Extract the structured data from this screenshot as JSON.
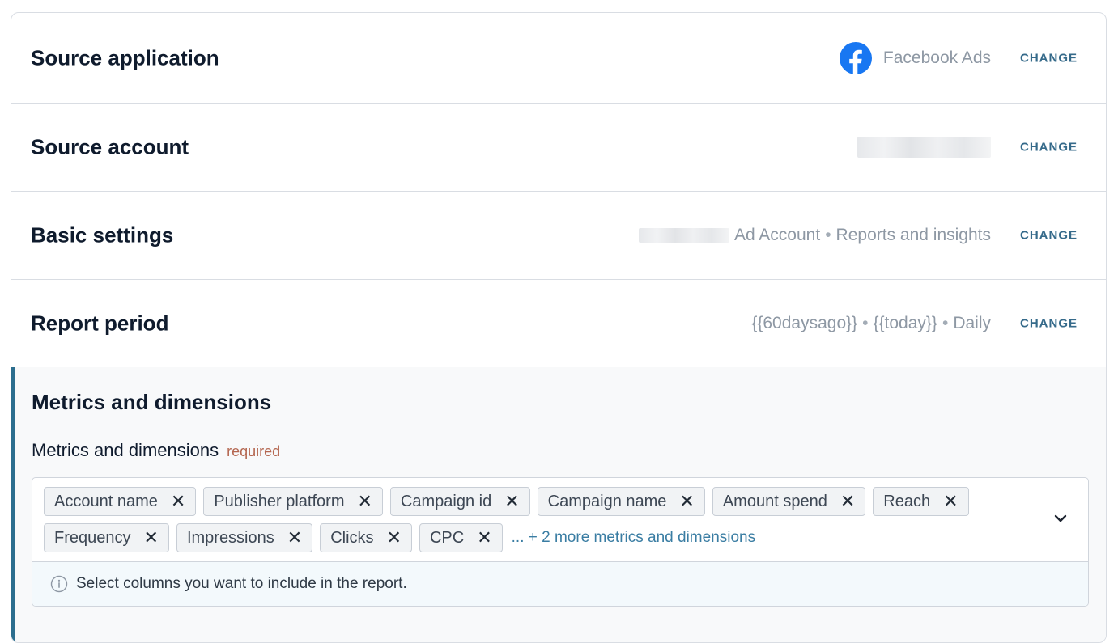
{
  "rows": [
    {
      "title": "Source application",
      "value": "Facebook Ads",
      "icon": "facebook-icon",
      "change": "CHANGE"
    },
    {
      "title": "Source account",
      "value": "",
      "change": "CHANGE"
    },
    {
      "title": "Basic settings",
      "value_parts": [
        "Ad Account",
        "•",
        "Reports and insights"
      ],
      "change": "CHANGE"
    },
    {
      "title": "Report period",
      "value_parts": [
        "{{60daysago}}",
        "•",
        "{{today}}",
        "•",
        "Daily"
      ],
      "change": "CHANGE"
    }
  ],
  "metrics": {
    "section_title": "Metrics and dimensions",
    "field_label": "Metrics and dimensions",
    "required_label": "required",
    "chips": [
      "Account name",
      "Publisher platform",
      "Campaign id",
      "Campaign name",
      "Amount spend",
      "Reach",
      "Frequency",
      "Impressions",
      "Clicks",
      "CPC"
    ],
    "more_link": "... + 2 more metrics and dimensions",
    "hint": "Select columns you want to include in the report.",
    "remove_glyph": "✕"
  },
  "colors": {
    "accent": "#2c6e8e",
    "change_link": "#356a8a",
    "facebook": "#1877f2",
    "required": "#b4664f"
  }
}
